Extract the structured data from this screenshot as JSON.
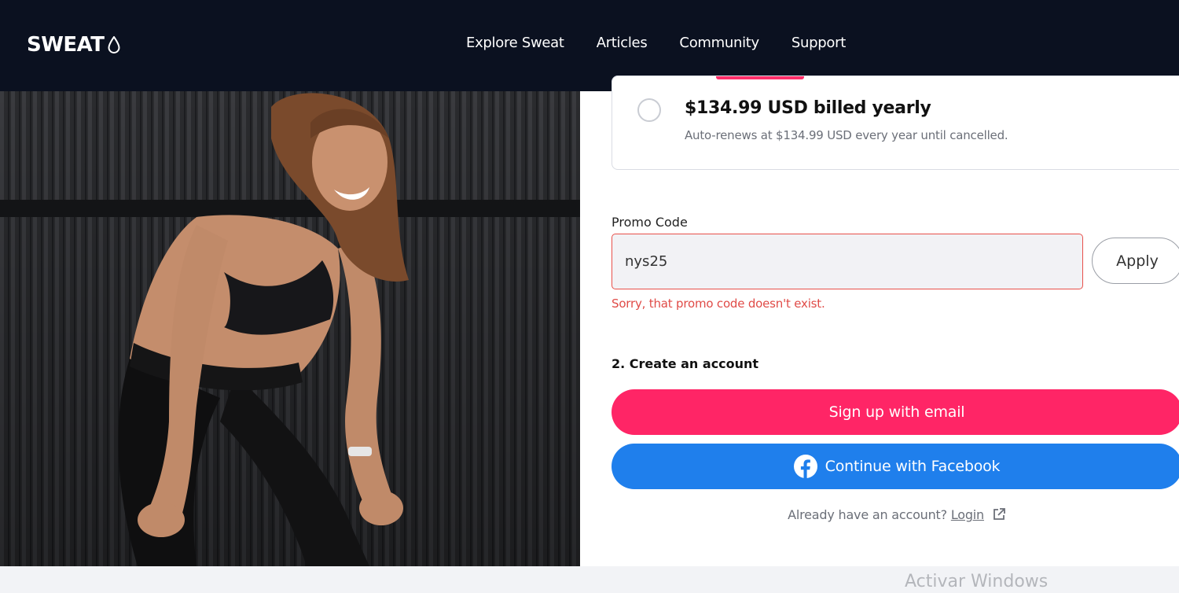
{
  "header": {
    "logo_text": "SWEAT",
    "nav": [
      "Explore Sweat",
      "Articles",
      "Community",
      "Support"
    ]
  },
  "plan": {
    "price": "$134.99 USD billed yearly",
    "note": "Auto-renews at $134.99 USD every year until cancelled.",
    "selected": false
  },
  "promo": {
    "label": "Promo Code",
    "value": "nys25",
    "apply_label": "Apply",
    "error": "Sorry, that promo code doesn't exist."
  },
  "account": {
    "title": "2. Create an account",
    "email_button": "Sign up with email",
    "facebook_button": "Continue with Facebook",
    "login_prompt": "Already have an account?",
    "login_link": "Login"
  },
  "watermark": "Activar Windows",
  "colors": {
    "header_bg": "#0b1120",
    "accent_pink": "#ff2566",
    "facebook_blue": "#1f7fec",
    "error_red": "#e04b47"
  },
  "icons": [
    "sweat-drop-icon",
    "radio-icon",
    "facebook-icon",
    "external-link-icon"
  ]
}
